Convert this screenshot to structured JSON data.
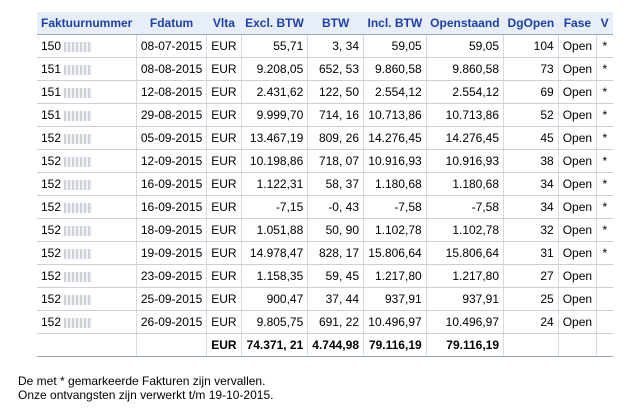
{
  "table": {
    "headers": [
      "Faktuurnummer",
      "Fdatum",
      "Vlta",
      "Excl. BTW",
      "BTW",
      "Incl. BTW",
      "Openstaand",
      "DgOpen",
      "Fase",
      "V"
    ],
    "rows": [
      {
        "nr": "150",
        "fdatum": "08-07-2015",
        "vlta": "EUR",
        "excl": "55,71",
        "btw": "3, 34",
        "incl": "59,05",
        "open": "59,05",
        "dg": "104",
        "fase": "Open",
        "v": "*"
      },
      {
        "nr": "151",
        "fdatum": "08-08-2015",
        "vlta": "EUR",
        "excl": "9.208,05",
        "btw": "652, 53",
        "incl": "9.860,58",
        "open": "9.860,58",
        "dg": "73",
        "fase": "Open",
        "v": "*"
      },
      {
        "nr": "151",
        "fdatum": "12-08-2015",
        "vlta": "EUR",
        "excl": "2.431,62",
        "btw": "122, 50",
        "incl": "2.554,12",
        "open": "2.554,12",
        "dg": "69",
        "fase": "Open",
        "v": "*"
      },
      {
        "nr": "151",
        "fdatum": "29-08-2015",
        "vlta": "EUR",
        "excl": "9.999,70",
        "btw": "714, 16",
        "incl": "10.713,86",
        "open": "10.713,86",
        "dg": "52",
        "fase": "Open",
        "v": "*"
      },
      {
        "nr": "152",
        "fdatum": "05-09-2015",
        "vlta": "EUR",
        "excl": "13.467,19",
        "btw": "809, 26",
        "incl": "14.276,45",
        "open": "14.276,45",
        "dg": "45",
        "fase": "Open",
        "v": "*"
      },
      {
        "nr": "152",
        "fdatum": "12-09-2015",
        "vlta": "EUR",
        "excl": "10.198,86",
        "btw": "718, 07",
        "incl": "10.916,93",
        "open": "10.916,93",
        "dg": "38",
        "fase": "Open",
        "v": "*"
      },
      {
        "nr": "152",
        "fdatum": "16-09-2015",
        "vlta": "EUR",
        "excl": "1.122,31",
        "btw": "58, 37",
        "incl": "1.180,68",
        "open": "1.180,68",
        "dg": "34",
        "fase": "Open",
        "v": "*"
      },
      {
        "nr": "152",
        "fdatum": "16-09-2015",
        "vlta": "EUR",
        "excl": "-7,15",
        "btw": "-0, 43",
        "incl": "-7,58",
        "open": "-7,58",
        "dg": "34",
        "fase": "Open",
        "v": "*"
      },
      {
        "nr": "152",
        "fdatum": "18-09-2015",
        "vlta": "EUR",
        "excl": "1.051,88",
        "btw": "50, 90",
        "incl": "1.102,78",
        "open": "1.102,78",
        "dg": "32",
        "fase": "Open",
        "v": "*"
      },
      {
        "nr": "152",
        "fdatum": "19-09-2015",
        "vlta": "EUR",
        "excl": "14.978,47",
        "btw": "828, 17",
        "incl": "15.806,64",
        "open": "15.806,64",
        "dg": "31",
        "fase": "Open",
        "v": "*"
      },
      {
        "nr": "152",
        "fdatum": "23-09-2015",
        "vlta": "EUR",
        "excl": "1.158,35",
        "btw": "59, 45",
        "incl": "1.217,80",
        "open": "1.217,80",
        "dg": "27",
        "fase": "Open",
        "v": ""
      },
      {
        "nr": "152",
        "fdatum": "25-09-2015",
        "vlta": "EUR",
        "excl": "900,47",
        "btw": "37, 44",
        "incl": "937,91",
        "open": "937,91",
        "dg": "25",
        "fase": "Open",
        "v": ""
      },
      {
        "nr": "152",
        "fdatum": "26-09-2015",
        "vlta": "EUR",
        "excl": "9.805,75",
        "btw": "691, 22",
        "incl": "10.496,97",
        "open": "10.496,97",
        "dg": "24",
        "fase": "Open",
        "v": ""
      }
    ],
    "totals": {
      "vlta": "EUR",
      "excl": "74.371, 21",
      "btw": "4.744,98",
      "incl": "79.116,19",
      "open": "79.116,19"
    }
  },
  "notes": {
    "line1": "De met * gemarkeerde Fakturen zijn vervallen.",
    "line2": "Onze ontvangsten zijn verwerkt t/m 19-10-2015."
  },
  "colors": {
    "header_text": "#1c3faa",
    "header_bg": "#e8eef8"
  }
}
